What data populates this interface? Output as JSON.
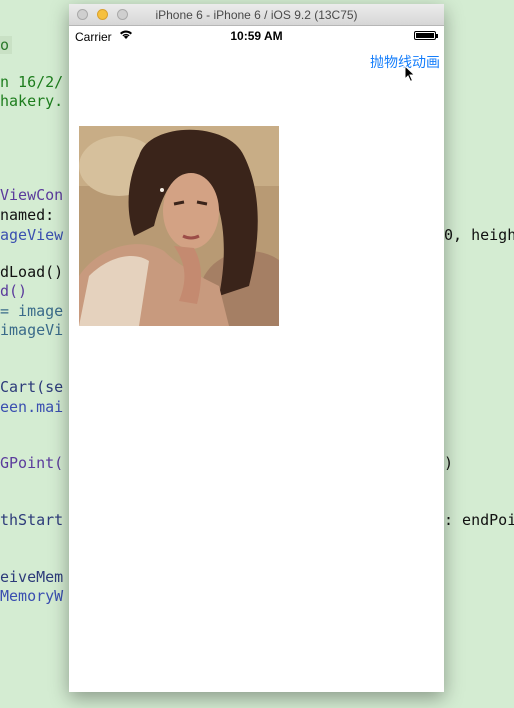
{
  "background_editor": {
    "lines": [
      {
        "text": "o",
        "color": "#2b7a2b"
      },
      {
        "text": "n 16/2/",
        "color": "#1d7d1d"
      },
      {
        "text": "hakery.",
        "color": "#1d7d1d"
      },
      {
        "text": "ViewCon",
        "color": "#5b3b9c"
      },
      {
        "text": "named:",
        "color": "#111111"
      },
      {
        "text": "ageView",
        "color": "#3a4fb0"
      },
      {
        "text": "dLoad()",
        "color": "#111111"
      },
      {
        "text": "d()",
        "color": "#5b3b9c"
      },
      {
        "text": "= image",
        "color": "#3a6b8a"
      },
      {
        "text": "imageVi",
        "color": "#3a6b8a"
      },
      {
        "text": "Cart(se",
        "color": "#2d3b7a"
      },
      {
        "text": "een.mai",
        "color": "#3a4fb0"
      },
      {
        "text": "GPoint(",
        "color": "#5b3b9c"
      },
      {
        "text": "thStart",
        "color": "#2d3b7a"
      },
      {
        "text": "eiveMem",
        "color": "#2d3b7a"
      },
      {
        "text": "MemoryW",
        "color": "#3a4fb0"
      },
      {
        "text": "0, heigh",
        "color": "#111111"
      },
      {
        "text": ")",
        "color": "#111111"
      },
      {
        "text": ": endPoi",
        "color": "#111111"
      }
    ]
  },
  "simulator": {
    "title": "iPhone 6 - iPhone 6 / iOS 9.2 (13C75)",
    "status": {
      "carrier": "Carrier",
      "time": "10:59 AM"
    },
    "nav_button_label": "抛物线动画"
  },
  "colors": {
    "ios_blue": "#157efb",
    "editor_bg": "#d4ecd2"
  }
}
